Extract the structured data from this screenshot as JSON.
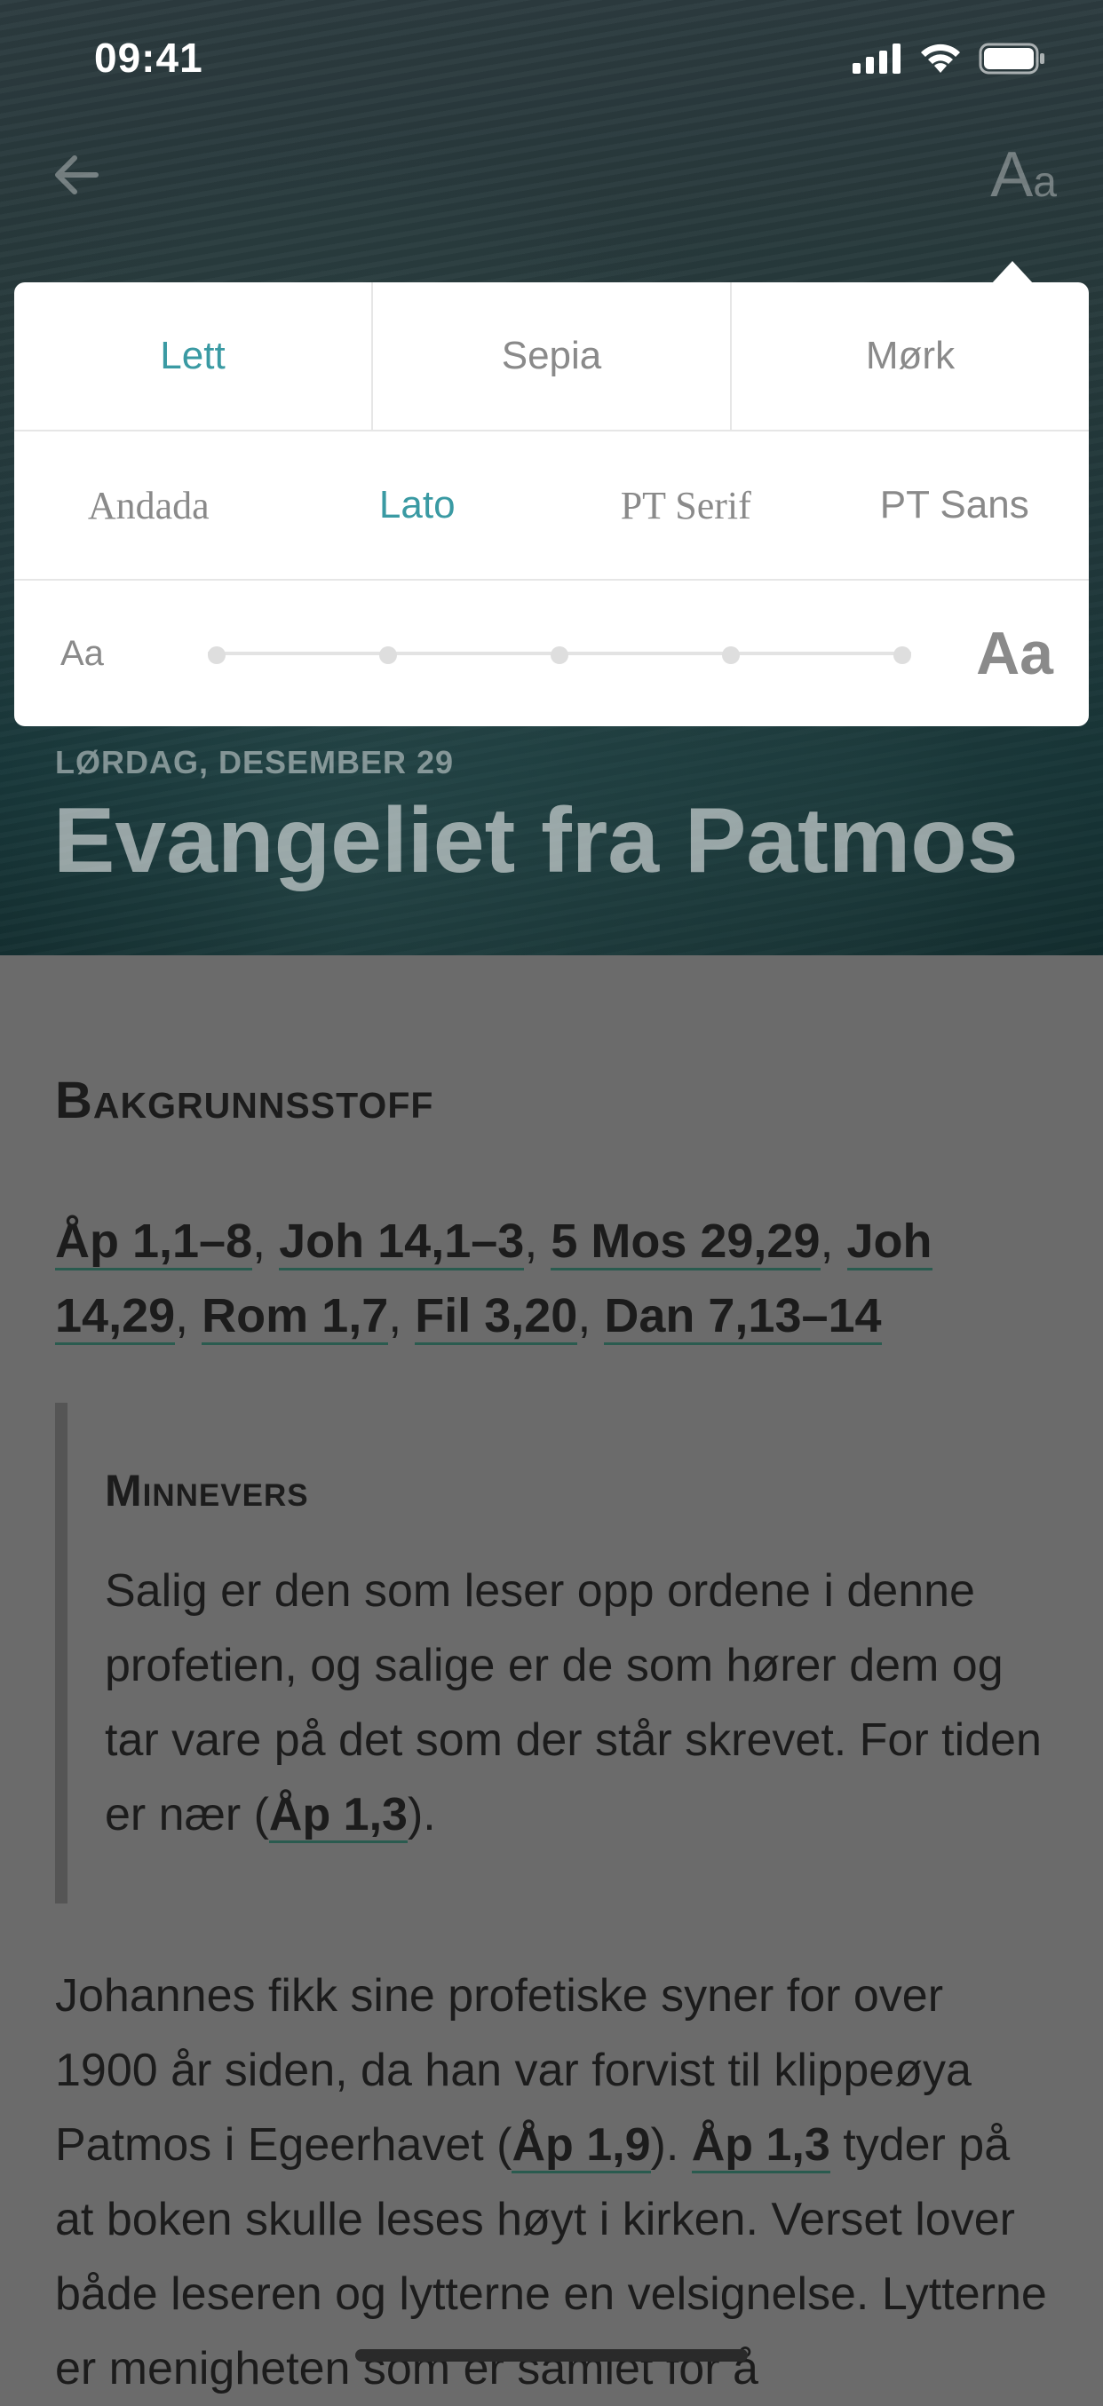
{
  "status_bar": {
    "time": "09:41"
  },
  "nav": {
    "font_button_big": "A",
    "font_button_small": "a"
  },
  "popover": {
    "themes": [
      {
        "label": "Lett",
        "active": true
      },
      {
        "label": "Sepia",
        "active": false
      },
      {
        "label": "Mørk",
        "active": false
      }
    ],
    "fonts": [
      {
        "label": "Andada",
        "active": false
      },
      {
        "label": "Lato",
        "active": true
      },
      {
        "label": "PT Serif",
        "active": false
      },
      {
        "label": "PT Sans",
        "active": false
      }
    ],
    "size_small_label": "Aa",
    "size_large_label": "Aa"
  },
  "hero": {
    "date": "LØRDAG, DESEMBER 29",
    "title": "Evangeliet fra Patmos"
  },
  "article": {
    "section_heading": "Bakgrunnsstoff",
    "refs": [
      "Åp 1,1–8",
      "Joh 14,1–3",
      "5 Mos 29,29",
      "Joh 14,29",
      "Rom 1,7",
      "Fil 3,20",
      "Dan 7,13–14"
    ],
    "verse_heading": "Minnevers",
    "verse_text": "Salig er den som leser opp ordene i denne profetien, og salige er de som hører dem og tar vare på det som der står skrevet. For tiden er nær (",
    "verse_ref": "Åp 1,3",
    "verse_end": ").",
    "body_1": "Johannes fikk sine profetiske syner for over 1900 år siden, da han var forvist til klippeøya Patmos i Egeerhavet (",
    "body_ref_1": "Åp 1,9",
    "body_2": "). ",
    "body_ref_2": "Åp 1,3",
    "body_3": " tyder på at boken skulle leses høyt i kirken. Verset lover både leseren og lytterne en velsignelse. Lytterne er menigheten som er samlet for å"
  }
}
